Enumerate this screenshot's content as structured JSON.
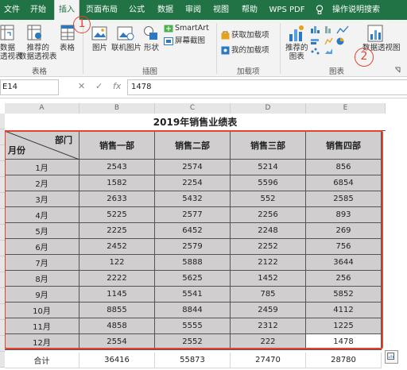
{
  "ribbon": {
    "tabs": [
      "文件",
      "开始",
      "插入",
      "页面布局",
      "公式",
      "数据",
      "审阅",
      "视图",
      "帮助",
      "WPS PDF"
    ],
    "tell_me": "操作说明搜索",
    "buttons": {
      "pivot": "数据\n透视表",
      "recommended_pivot": "推荐的\n数据透视表",
      "table": "表格",
      "picture": "图片",
      "online_picture": "联机图片",
      "shapes": "形状",
      "smartart": "SmartArt",
      "screenshot": "屏幕截图",
      "get_addins": "获取加载项",
      "my_addins": "我的加载项",
      "recommended_charts": "推荐的\n图表",
      "pivot_chart": "数据透视图"
    },
    "groups": {
      "tables": "表格",
      "illustrations": "插图",
      "addins": "加载项",
      "charts": "图表"
    }
  },
  "formula_bar": {
    "name_box": "E14",
    "cancel": "✕",
    "confirm": "✓",
    "fx": "fx",
    "value": "1478"
  },
  "sheet": {
    "columns": [
      "A",
      "B",
      "C",
      "D",
      "E"
    ],
    "title": "2019年销售业绩表",
    "corner": {
      "top": "部门",
      "bottom": "月份"
    },
    "headers": [
      "销售一部",
      "销售二部",
      "销售三部",
      "销售四部"
    ],
    "rows": [
      {
        "month": "1月",
        "values": [
          "2543",
          "2574",
          "5214",
          "856"
        ]
      },
      {
        "month": "2月",
        "values": [
          "1582",
          "2254",
          "5596",
          "6854"
        ]
      },
      {
        "month": "3月",
        "values": [
          "2633",
          "5432",
          "552",
          "2585"
        ]
      },
      {
        "month": "4月",
        "values": [
          "5225",
          "2577",
          "2256",
          "893"
        ]
      },
      {
        "month": "5月",
        "values": [
          "2225",
          "6452",
          "2248",
          "269"
        ]
      },
      {
        "month": "6月",
        "values": [
          "2452",
          "2579",
          "2252",
          "756"
        ]
      },
      {
        "month": "7月",
        "values": [
          "122",
          "5888",
          "2122",
          "3644"
        ]
      },
      {
        "month": "8月",
        "values": [
          "2222",
          "5625",
          "1452",
          "256"
        ]
      },
      {
        "month": "9月",
        "values": [
          "1145",
          "5541",
          "785",
          "5852"
        ]
      },
      {
        "month": "10月",
        "values": [
          "8855",
          "8844",
          "2459",
          "4112"
        ]
      },
      {
        "month": "11月",
        "values": [
          "4858",
          "5555",
          "2312",
          "1225"
        ]
      },
      {
        "month": "12月",
        "values": [
          "2554",
          "2552",
          "222",
          "1478"
        ]
      }
    ],
    "total": {
      "label": "合计",
      "values": [
        "36416",
        "55873",
        "27470",
        "28780"
      ]
    }
  },
  "annotations": [
    "1",
    "2"
  ],
  "colors": {
    "excel_green": "#217346",
    "table_fill": "#d0cece",
    "annotation_red": "#e2442f"
  }
}
